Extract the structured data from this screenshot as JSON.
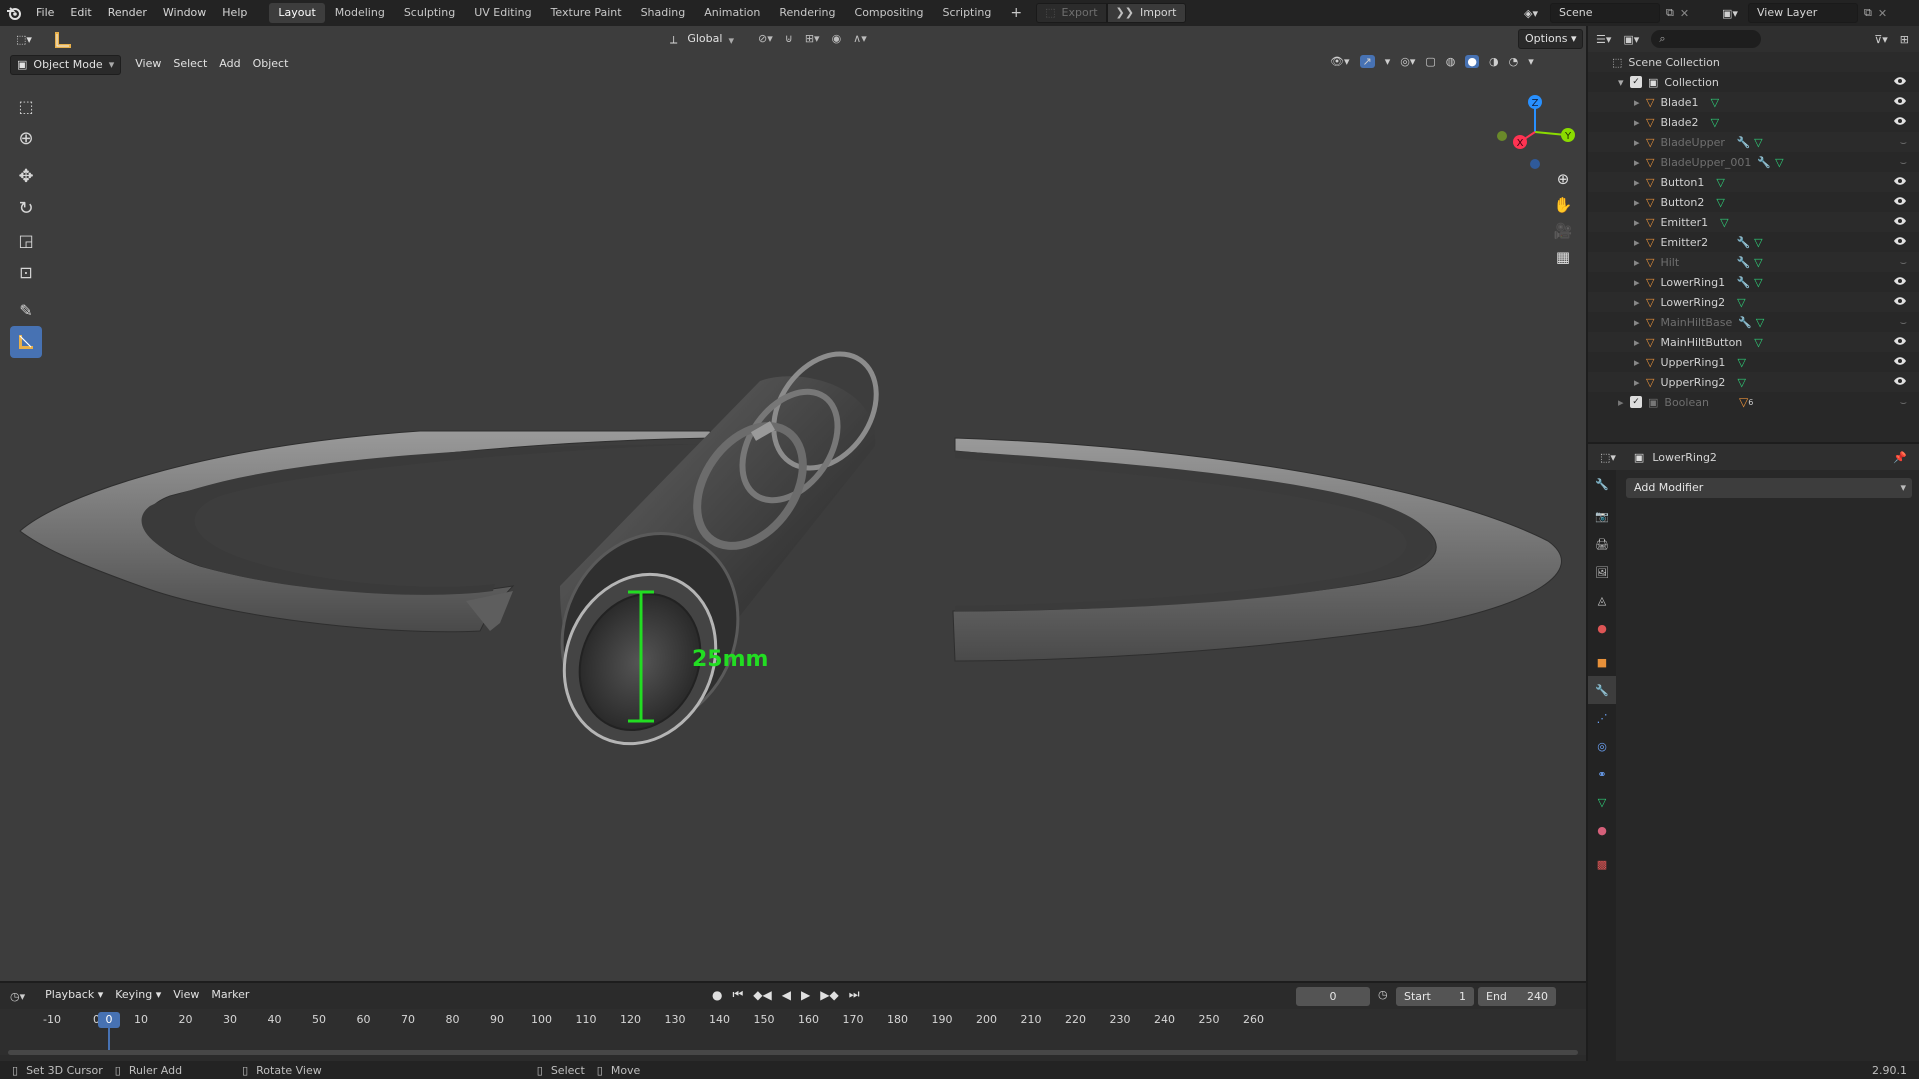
{
  "topbar": {
    "menus": [
      "File",
      "Edit",
      "Render",
      "Window",
      "Help"
    ],
    "workspaces": [
      "Layout",
      "Modeling",
      "Sculpting",
      "UV Editing",
      "Texture Paint",
      "Shading",
      "Animation",
      "Rendering",
      "Compositing",
      "Scripting"
    ],
    "active_workspace": "Layout",
    "add_tab": "+",
    "export_label": "Export",
    "import_label": "Import",
    "scene_name": "Scene",
    "view_layer": "View Layer"
  },
  "viewport": {
    "transform_orientation": "Global",
    "options_label": "Options",
    "mode": "Object Mode",
    "menus": [
      "View",
      "Select",
      "Add",
      "Object"
    ],
    "measure_label": "25mm",
    "gizmo": {
      "z": "Z",
      "y": "Y",
      "x": "X"
    }
  },
  "outliner": {
    "search_placeholder": "",
    "scene_collection": "Scene Collection",
    "collection": "Collection",
    "items": [
      {
        "name": "Blade1",
        "visible": true,
        "modifier": false
      },
      {
        "name": "Blade2",
        "visible": true,
        "modifier": false
      },
      {
        "name": "BladeUpper",
        "visible": false,
        "modifier": true
      },
      {
        "name": "BladeUpper_001",
        "visible": false,
        "modifier": true
      },
      {
        "name": "Button1",
        "visible": true,
        "modifier": false
      },
      {
        "name": "Button2",
        "visible": true,
        "modifier": false
      },
      {
        "name": "Emitter1",
        "visible": true,
        "modifier": false
      },
      {
        "name": "Emitter2",
        "visible": true,
        "modifier": true
      },
      {
        "name": "Hilt",
        "visible": false,
        "modifier": true
      },
      {
        "name": "LowerRing1",
        "visible": true,
        "modifier": true
      },
      {
        "name": "LowerRing2",
        "visible": true,
        "modifier": false
      },
      {
        "name": "MainHiltBase",
        "visible": false,
        "modifier": true
      },
      {
        "name": "MainHiltButton",
        "visible": true,
        "modifier": false
      },
      {
        "name": "UpperRing1",
        "visible": true,
        "modifier": false
      },
      {
        "name": "UpperRing2",
        "visible": true,
        "modifier": false
      }
    ],
    "boolean_collection": "Boolean",
    "boolean_count": "6"
  },
  "properties": {
    "object_name": "LowerRing2",
    "add_modifier": "Add Modifier"
  },
  "timeline": {
    "menus": [
      "Playback",
      "Keying",
      "View",
      "Marker"
    ],
    "current_frame": "0",
    "start_label": "Start",
    "start_value": "1",
    "end_label": "End",
    "end_value": "240",
    "ruler": [
      "-10",
      "0",
      "10",
      "20",
      "30",
      "40",
      "50",
      "60",
      "70",
      "80",
      "90",
      "100",
      "110",
      "120",
      "130",
      "140",
      "150",
      "160",
      "170",
      "180",
      "190",
      "200",
      "210",
      "220",
      "230",
      "240",
      "250",
      "260"
    ]
  },
  "statusbar": {
    "set_cursor": "Set 3D Cursor",
    "ruler_add": "Ruler Add",
    "rotate_view": "Rotate View",
    "select": "Select",
    "move": "Move",
    "version": "2.90.1"
  },
  "colors": {
    "accent_blue": "#4772b3",
    "measure_green": "#22dd22",
    "mesh_icon_green": "#2fd27a",
    "object_orange": "#e8913a",
    "axis_x": "#ff3352",
    "axis_y": "#8bdc00",
    "axis_z": "#2890ff"
  }
}
